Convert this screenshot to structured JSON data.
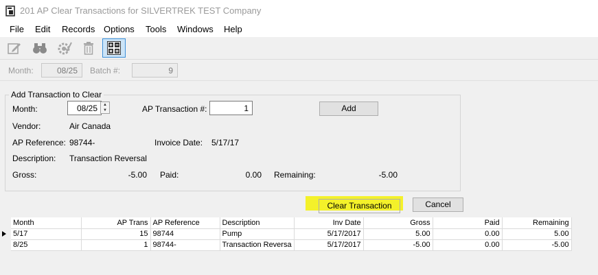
{
  "window": {
    "title": "201 AP Clear Transactions for SILVERTREK TEST Company"
  },
  "menu": [
    "File",
    "Edit",
    "Records",
    "Options",
    "Tools",
    "Windows",
    "Help"
  ],
  "header": {
    "month_label": "Month:",
    "month_value": "08/25",
    "batch_label": "Batch #:",
    "batch_value": "9"
  },
  "add_group": {
    "title": "Add Transaction to Clear",
    "month_label": "Month:",
    "month_value": "08/25",
    "ap_trans_label": "AP Transaction #:",
    "ap_trans_value": "1",
    "add_button": "Add",
    "vendor_label": "Vendor:",
    "vendor_value": "Air Canada",
    "ap_ref_label": "AP Reference:",
    "ap_ref_value": "98744-",
    "invoice_date_label": "Invoice Date:",
    "invoice_date_value": "5/17/17",
    "description_label": "Description:",
    "description_value": "Transaction Reversal",
    "gross_label": "Gross:",
    "gross_value": "-5.00",
    "paid_label": "Paid:",
    "paid_value": "0.00",
    "remaining_label": "Remaining:",
    "remaining_value": "-5.00"
  },
  "actions": {
    "clear_transaction": "Clear Transaction",
    "cancel": "Cancel"
  },
  "grid": {
    "columns": [
      "Month",
      "AP Trans",
      "AP Reference",
      "Description",
      "Inv Date",
      "Gross",
      "Paid",
      "Remaining"
    ],
    "rows": [
      [
        "5/17",
        "15",
        "98744",
        "Pump",
        "5/17/2017",
        "5.00",
        "0.00",
        "5.00"
      ],
      [
        "8/25",
        "1",
        "98744-",
        "Transaction Reversa",
        "5/17/2017",
        "-5.00",
        "0.00",
        "-5.00"
      ]
    ]
  },
  "colors": {
    "highlight": "#f4f12a",
    "toolbar_active": "#cce4f7"
  }
}
